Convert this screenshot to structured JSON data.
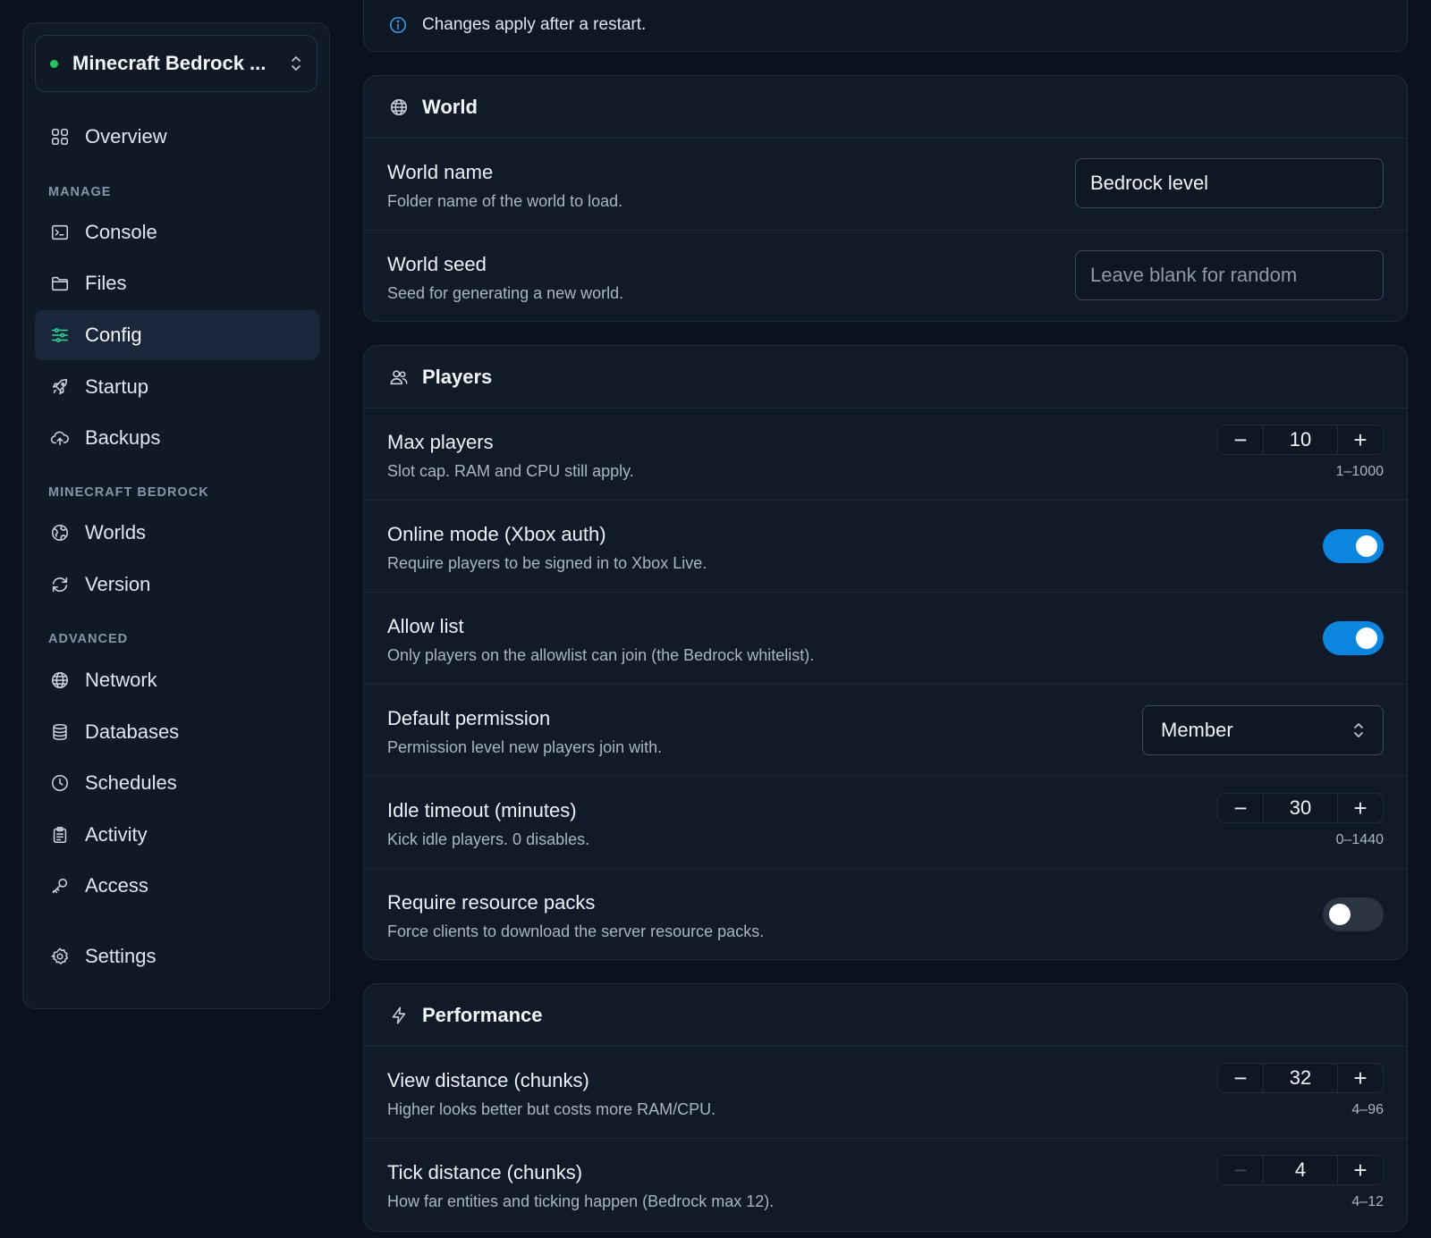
{
  "sidebar": {
    "server": {
      "name": "Minecraft Bedrock ...",
      "status_color": "#22c55e"
    },
    "overview": {
      "label": "Overview",
      "icon": "grid-icon"
    },
    "sections": {
      "manage": "MANAGE",
      "game": "MINECRAFT BEDROCK",
      "advanced": "ADVANCED"
    },
    "items": {
      "console": {
        "label": "Console",
        "icon": "terminal-icon"
      },
      "files": {
        "label": "Files",
        "icon": "folder-icon"
      },
      "config": {
        "label": "Config",
        "icon": "sliders-icon",
        "active": true
      },
      "startup": {
        "label": "Startup",
        "icon": "rocket-icon"
      },
      "backups": {
        "label": "Backups",
        "icon": "cloud-upload-icon"
      },
      "worlds": {
        "label": "Worlds",
        "icon": "earth-icon"
      },
      "version": {
        "label": "Version",
        "icon": "refresh-icon"
      },
      "network": {
        "label": "Network",
        "icon": "globe-icon"
      },
      "databases": {
        "label": "Databases",
        "icon": "database-icon"
      },
      "schedules": {
        "label": "Schedules",
        "icon": "clock-icon"
      },
      "activity": {
        "label": "Activity",
        "icon": "clipboard-icon"
      },
      "access": {
        "label": "Access",
        "icon": "key-icon"
      },
      "settings": {
        "label": "Settings",
        "icon": "gear-icon"
      }
    }
  },
  "notice": {
    "text": "Changes apply after a restart.",
    "icon": "info-icon",
    "color": "#3b9be8"
  },
  "world": {
    "title": "World",
    "icon": "globe-icon",
    "name": {
      "label": "World name",
      "desc": "Folder name of the world to load.",
      "value": "Bedrock level"
    },
    "seed": {
      "label": "World seed",
      "desc": "Seed for generating a new world.",
      "value": "",
      "placeholder": "Leave blank for random"
    }
  },
  "players": {
    "title": "Players",
    "icon": "users-icon",
    "max_players": {
      "label": "Max players",
      "desc": "Slot cap. RAM and CPU still apply.",
      "value": "10",
      "range": "1–1000"
    },
    "online_mode": {
      "label": "Online mode (Xbox auth)",
      "desc": "Require players to be signed in to Xbox Live.",
      "enabled": true
    },
    "allow_list": {
      "label": "Allow list",
      "desc": "Only players on the allowlist can join (the Bedrock whitelist).",
      "enabled": true
    },
    "default_permission": {
      "label": "Default permission",
      "desc": "Permission level new players join with.",
      "value": "Member"
    },
    "idle_timeout": {
      "label": "Idle timeout (minutes)",
      "desc": "Kick idle players. 0 disables.",
      "value": "30",
      "range": "0–1440"
    },
    "resource_packs": {
      "label": "Require resource packs",
      "desc": "Force clients to download the server resource packs.",
      "enabled": false
    }
  },
  "performance": {
    "title": "Performance",
    "icon": "bolt-icon",
    "view_distance": {
      "label": "View distance (chunks)",
      "desc": "Higher looks better but costs more RAM/CPU.",
      "value": "32",
      "range": "4–96"
    },
    "tick_distance": {
      "label": "Tick distance (chunks)",
      "desc": "How far entities and ticking happen (Bedrock max 12).",
      "value": "4",
      "range": "4–12"
    }
  },
  "colors": {
    "accent": "#0a86de",
    "active_icon": "#34d399",
    "background": "#0b121d"
  }
}
